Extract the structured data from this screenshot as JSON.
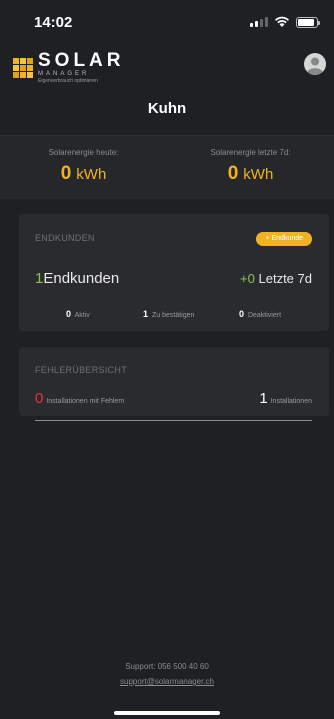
{
  "status_bar": {
    "time": "14:02"
  },
  "header": {
    "logo_title": "SOLAR",
    "logo_subtitle": "MANAGER",
    "logo_tagline": "Eigenverbrauch optimieren",
    "page_title": "Kuhn"
  },
  "energy": {
    "today_label": "Solarenergie heute:",
    "today_value": "0",
    "today_unit": "kWh",
    "week_label": "Solarenergie letzte 7d:",
    "week_value": "0",
    "week_unit": "kWh"
  },
  "endkunden": {
    "heading": "ENDKUNDEN",
    "add_button": "+ Endkunde",
    "count": "1",
    "count_label": "Endkunden",
    "recent_count": "+0",
    "recent_label": "Letzte 7d",
    "stats": [
      {
        "value": "0",
        "label": "Aktiv"
      },
      {
        "value": "1",
        "label": "Zu bestätigen"
      },
      {
        "value": "0",
        "label": "Deaktiviert"
      }
    ]
  },
  "fehler": {
    "heading": "FEHLERÜBERSICHT",
    "error_count": "0",
    "error_label": "Installationen mit Fehlern",
    "total_count": "1",
    "total_label": "Installationen"
  },
  "footer": {
    "support": "Support: 056 500 40 60",
    "email": "support@solarmanager.ch"
  },
  "colors": {
    "accent": "#f0b323",
    "success": "#8bc34a",
    "error": "#e53935",
    "background": "#1f2024"
  }
}
